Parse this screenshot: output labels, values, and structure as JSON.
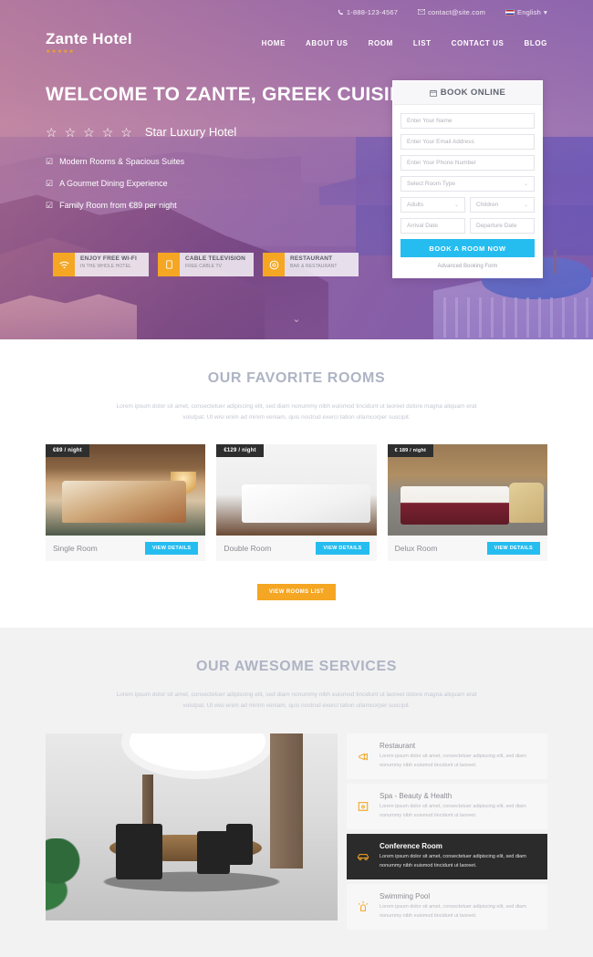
{
  "topbar": {
    "phone": "1-888-123-4567",
    "email": "contact@site.com",
    "language": "English",
    "language_caret": "▾",
    "phone_icon": "phone-icon",
    "email_icon": "envelope-icon",
    "flag_icon": "flag-icon"
  },
  "brand": {
    "name": "Zante Hotel",
    "stars": "★★★★★"
  },
  "nav": {
    "items": [
      {
        "label": "HOME"
      },
      {
        "label": "ABOUT US"
      },
      {
        "label": "ROOM"
      },
      {
        "label": "LIST"
      },
      {
        "label": "CONTACT US"
      },
      {
        "label": "BLOG"
      }
    ]
  },
  "hero": {
    "title": "WELCOME TO ZANTE, GREEK CUISINE",
    "star_glyph": "☆",
    "star_count": 5,
    "subtitle": "Star Luxury Hotel",
    "check_glyph": "☑",
    "bullets": [
      {
        "text": "Modern Rooms & Spacious Suites"
      },
      {
        "text": "A Gourmet Dining Experience"
      },
      {
        "text": "Family Room from €89 per night"
      }
    ],
    "scroll_glyph": "⌄"
  },
  "features": [
    {
      "icon": "wifi-icon",
      "glyph": "◔",
      "title": "ENJOY FREE WI-FI",
      "subtitle": "IN THE WHOLE HOTEL"
    },
    {
      "icon": "tv-icon",
      "glyph": "▯",
      "title": "CABLE TELEVISION",
      "subtitle": "FREE CABLE TV"
    },
    {
      "icon": "restaurant-icon",
      "glyph": "◎",
      "title": "RESTAURANT",
      "subtitle": "BAR & RESTAURANT"
    }
  ],
  "booking": {
    "heading": "BOOK ONLINE",
    "calendar_icon": "calendar-icon",
    "name_placeholder": "Enter Your Name",
    "email_placeholder": "Enter Your Email Address",
    "phone_placeholder": "Enter Your Phone Number",
    "room_type_placeholder": "Select Room Type",
    "adults_placeholder": "Adults",
    "children_placeholder": "Children",
    "arrival_placeholder": "Arrival Date",
    "departure_placeholder": "Departure Date",
    "caret": "⌄",
    "submit_label": "BOOK A ROOM NOW",
    "advanced_link": "Advanced Booking Form",
    "accent_color": "#25bdf0"
  },
  "rooms_section": {
    "title": "OUR FAVORITE ROOMS",
    "description": "Lorem ipsum dolor sit amet, consectetuer adipiscing elit, sed diam nonummy nibh euismod tincidunt ut laoreet dolore magna aliquam erat volutpat. Ut wisi enim ad minim veniam, quis nostrud exerci tation ullamcorper suscipit.",
    "cta_label": "VIEW ROOMS LIST",
    "cta_color": "#f5a623",
    "cards": [
      {
        "badge": "€89 / night",
        "name": "Single Room",
        "button": "VIEW DETAILS",
        "photo": "single-room-photo"
      },
      {
        "badge": "€129 / night",
        "name": "Double Room",
        "button": "VIEW DETAILS",
        "photo": "double-room-photo"
      },
      {
        "badge": "€ 189 / night",
        "name": "Delux Room",
        "button": "VIEW DETAILS",
        "photo": "delux-room-photo"
      }
    ]
  },
  "services_section": {
    "title": "OUR AWESOME SERVICES",
    "description": "Lorem ipsum dolor sit amet, consectetuer adipiscing elit, sed diam nonummy nibh euismod tincidunt ut laoreet dolore magna aliquam erat volutpat. Ut wisi enim ad minim veniam, quis nostrud exerci tation ullamcorper suscipit.",
    "photo": "conference-room-photo",
    "items": [
      {
        "icon": "megaphone-icon",
        "glyph": "✐",
        "title": "Restaurant",
        "desc": "Lorem ipsum dolor sit amet, consectetuer adipiscing elit, sed diam nonummy nibh euismod tincidunt ut laoreet.",
        "active": false
      },
      {
        "icon": "spa-icon",
        "glyph": "▣",
        "title": "Spa - Beauty & Health",
        "desc": "Lorem ipsum dolor sit amet, consectetuer adipiscing elit, sed diam nonummy nibh euismod tincidunt ut laoreet.",
        "active": false
      },
      {
        "icon": "car-icon",
        "glyph": "⛌",
        "title": "Conference Room",
        "desc": "Lorem ipsum dolor sit amet, consectetuer adipiscing elit, sed diam nonummy nibh euismod tincidunt ut laoreet.",
        "active": true
      },
      {
        "icon": "lamp-icon",
        "glyph": "⌂",
        "title": "Swimming Pool",
        "desc": "Lorem ipsum dolor sit amet, consectetuer adipiscing elit, sed diam nonummy nibh euismod tincidunt ut laoreet.",
        "active": false
      }
    ]
  }
}
